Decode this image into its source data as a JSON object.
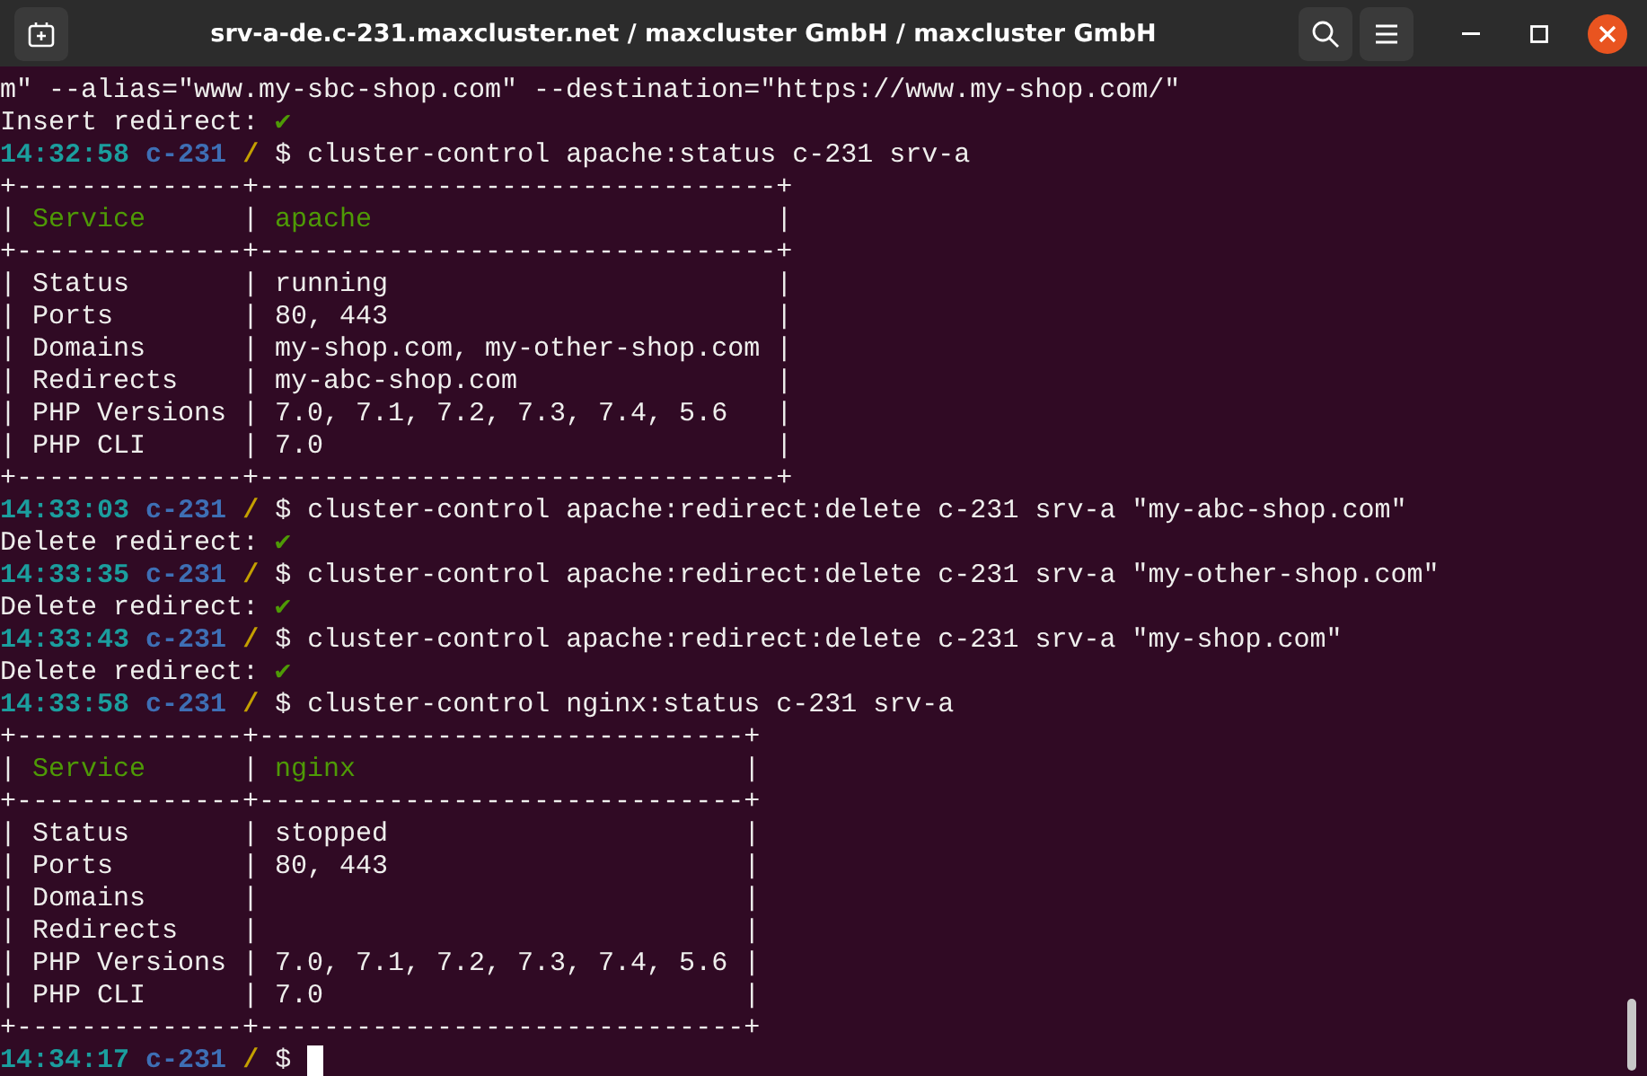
{
  "window": {
    "title": "srv-a-de.c-231.maxcluster.net / maxcluster GmbH / maxcluster GmbH"
  },
  "lines": [
    {
      "kind": "text",
      "parts": [
        {
          "text": "m\" --alias=\"www.my-sbc-shop.com\" --destination=\"https://www.my-shop.com/\"",
          "kind": "plain"
        }
      ]
    },
    {
      "kind": "status",
      "text": "Insert redirect:",
      "mark": "✔"
    },
    {
      "kind": "prompt",
      "time": "14:32:58",
      "host": "c-231",
      "path": "/",
      "symbol": "$",
      "command": "cluster-control apache:status c-231 srv-a"
    },
    {
      "kind": "text",
      "parts": [
        {
          "text": "+--------------+--------------------------------+",
          "kind": "plain"
        }
      ]
    },
    {
      "kind": "text",
      "parts": [
        {
          "text": "| ",
          "kind": "plain"
        },
        {
          "text": "Service",
          "kind": "heading"
        },
        {
          "text": "      | ",
          "kind": "plain"
        },
        {
          "text": "apache",
          "kind": "heading"
        },
        {
          "text": "                         |",
          "kind": "plain"
        }
      ]
    },
    {
      "kind": "text",
      "parts": [
        {
          "text": "+--------------+--------------------------------+",
          "kind": "plain"
        }
      ]
    },
    {
      "kind": "text",
      "parts": [
        {
          "text": "| Status       | running                        |",
          "kind": "plain"
        }
      ]
    },
    {
      "kind": "text",
      "parts": [
        {
          "text": "| Ports        | 80, 443                        |",
          "kind": "plain"
        }
      ]
    },
    {
      "kind": "text",
      "parts": [
        {
          "text": "| Domains      | my-shop.com, my-other-shop.com |",
          "kind": "plain"
        }
      ]
    },
    {
      "kind": "text",
      "parts": [
        {
          "text": "| Redirects    | my-abc-shop.com                |",
          "kind": "plain"
        }
      ]
    },
    {
      "kind": "text",
      "parts": [
        {
          "text": "| PHP Versions | 7.0, 7.1, 7.2, 7.3, 7.4, 5.6   |",
          "kind": "plain"
        }
      ]
    },
    {
      "kind": "text",
      "parts": [
        {
          "text": "| PHP CLI      | 7.0                            |",
          "kind": "plain"
        }
      ]
    },
    {
      "kind": "text",
      "parts": [
        {
          "text": "+--------------+--------------------------------+",
          "kind": "plain"
        }
      ]
    },
    {
      "kind": "prompt",
      "time": "14:33:03",
      "host": "c-231",
      "path": "/",
      "symbol": "$",
      "command": "cluster-control apache:redirect:delete c-231 srv-a \"my-abc-shop.com\""
    },
    {
      "kind": "status",
      "text": "Delete redirect:",
      "mark": "✔"
    },
    {
      "kind": "prompt",
      "time": "14:33:35",
      "host": "c-231",
      "path": "/",
      "symbol": "$",
      "command": "cluster-control apache:redirect:delete c-231 srv-a \"my-other-shop.com\""
    },
    {
      "kind": "status",
      "text": "Delete redirect:",
      "mark": "✔"
    },
    {
      "kind": "prompt",
      "time": "14:33:43",
      "host": "c-231",
      "path": "/",
      "symbol": "$",
      "command": "cluster-control apache:redirect:delete c-231 srv-a \"my-shop.com\""
    },
    {
      "kind": "status",
      "text": "Delete redirect:",
      "mark": "✔"
    },
    {
      "kind": "prompt",
      "time": "14:33:58",
      "host": "c-231",
      "path": "/",
      "symbol": "$",
      "command": "cluster-control nginx:status c-231 srv-a"
    },
    {
      "kind": "text",
      "parts": [
        {
          "text": "+--------------+------------------------------+",
          "kind": "plain"
        }
      ]
    },
    {
      "kind": "text",
      "parts": [
        {
          "text": "| ",
          "kind": "plain"
        },
        {
          "text": "Service",
          "kind": "heading"
        },
        {
          "text": "      | ",
          "kind": "plain"
        },
        {
          "text": "nginx",
          "kind": "heading"
        },
        {
          "text": "                        |",
          "kind": "plain"
        }
      ]
    },
    {
      "kind": "text",
      "parts": [
        {
          "text": "+--------------+------------------------------+",
          "kind": "plain"
        }
      ]
    },
    {
      "kind": "text",
      "parts": [
        {
          "text": "| Status       | stopped                      |",
          "kind": "plain"
        }
      ]
    },
    {
      "kind": "text",
      "parts": [
        {
          "text": "| Ports        | 80, 443                      |",
          "kind": "plain"
        }
      ]
    },
    {
      "kind": "text",
      "parts": [
        {
          "text": "| Domains      |                              |",
          "kind": "plain"
        }
      ]
    },
    {
      "kind": "text",
      "parts": [
        {
          "text": "| Redirects    |                              |",
          "kind": "plain"
        }
      ]
    },
    {
      "kind": "text",
      "parts": [
        {
          "text": "| PHP Versions | 7.0, 7.1, 7.2, 7.3, 7.4, 5.6 |",
          "kind": "plain"
        }
      ]
    },
    {
      "kind": "text",
      "parts": [
        {
          "text": "| PHP CLI      | 7.0                          |",
          "kind": "plain"
        }
      ]
    },
    {
      "kind": "text",
      "parts": [
        {
          "text": "+--------------+------------------------------+",
          "kind": "plain"
        }
      ]
    },
    {
      "kind": "input",
      "time": "14:34:17",
      "host": "c-231",
      "path": "/",
      "symbol": "$"
    }
  ]
}
